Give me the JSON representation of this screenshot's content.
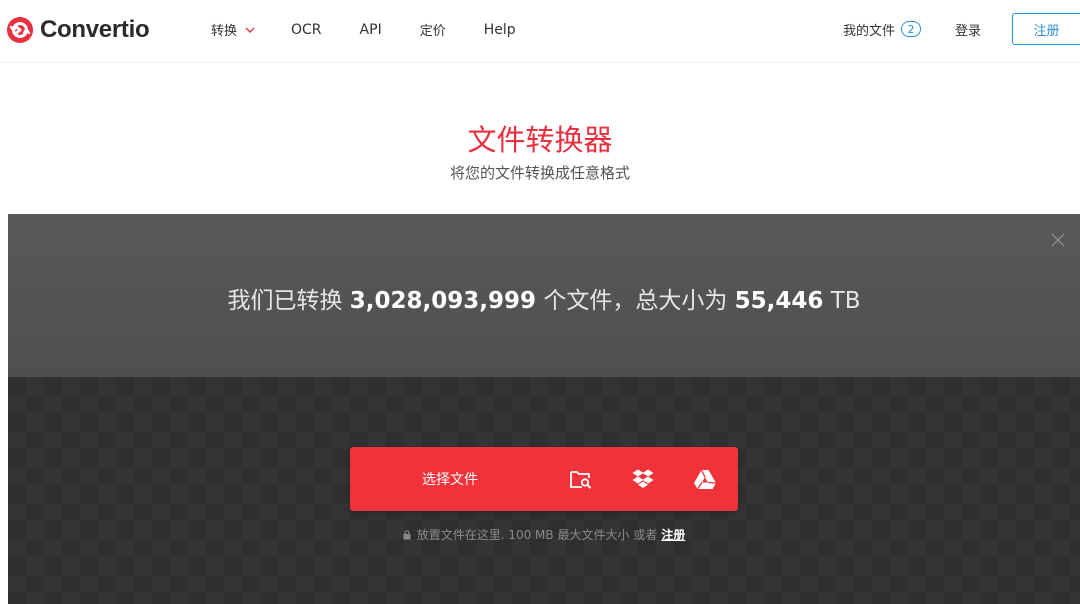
{
  "header": {
    "logo_text": "Convertio",
    "nav": [
      {
        "label": "转换",
        "has_dropdown": true
      },
      {
        "label": "OCR"
      },
      {
        "label": "API"
      },
      {
        "label": "定价"
      },
      {
        "label": "Help"
      }
    ],
    "my_files_label": "我的文件",
    "my_files_count": "2",
    "login_label": "登录",
    "register_label": "注册"
  },
  "hero": {
    "title": "文件转换器",
    "subtitle": "将您的文件转换成任意格式"
  },
  "stats": {
    "prefix": "我们已转换",
    "files_count": "3,028,093,999",
    "middle": "个文件，总大小为",
    "total_size": "55,446",
    "unit": "TB"
  },
  "upload": {
    "choose_label": "选择文件",
    "sources": [
      {
        "icon": "folder-search-icon"
      },
      {
        "icon": "dropbox-icon"
      },
      {
        "icon": "google-drive-icon"
      }
    ],
    "hint_text": "放置文件在这里. 100 MB 最大文件大小 或者",
    "hint_link": "注册"
  },
  "colors": {
    "brand_red": "#f0333a",
    "link_blue": "#2a8fd8",
    "panel_dark": "#2e2e2e"
  }
}
